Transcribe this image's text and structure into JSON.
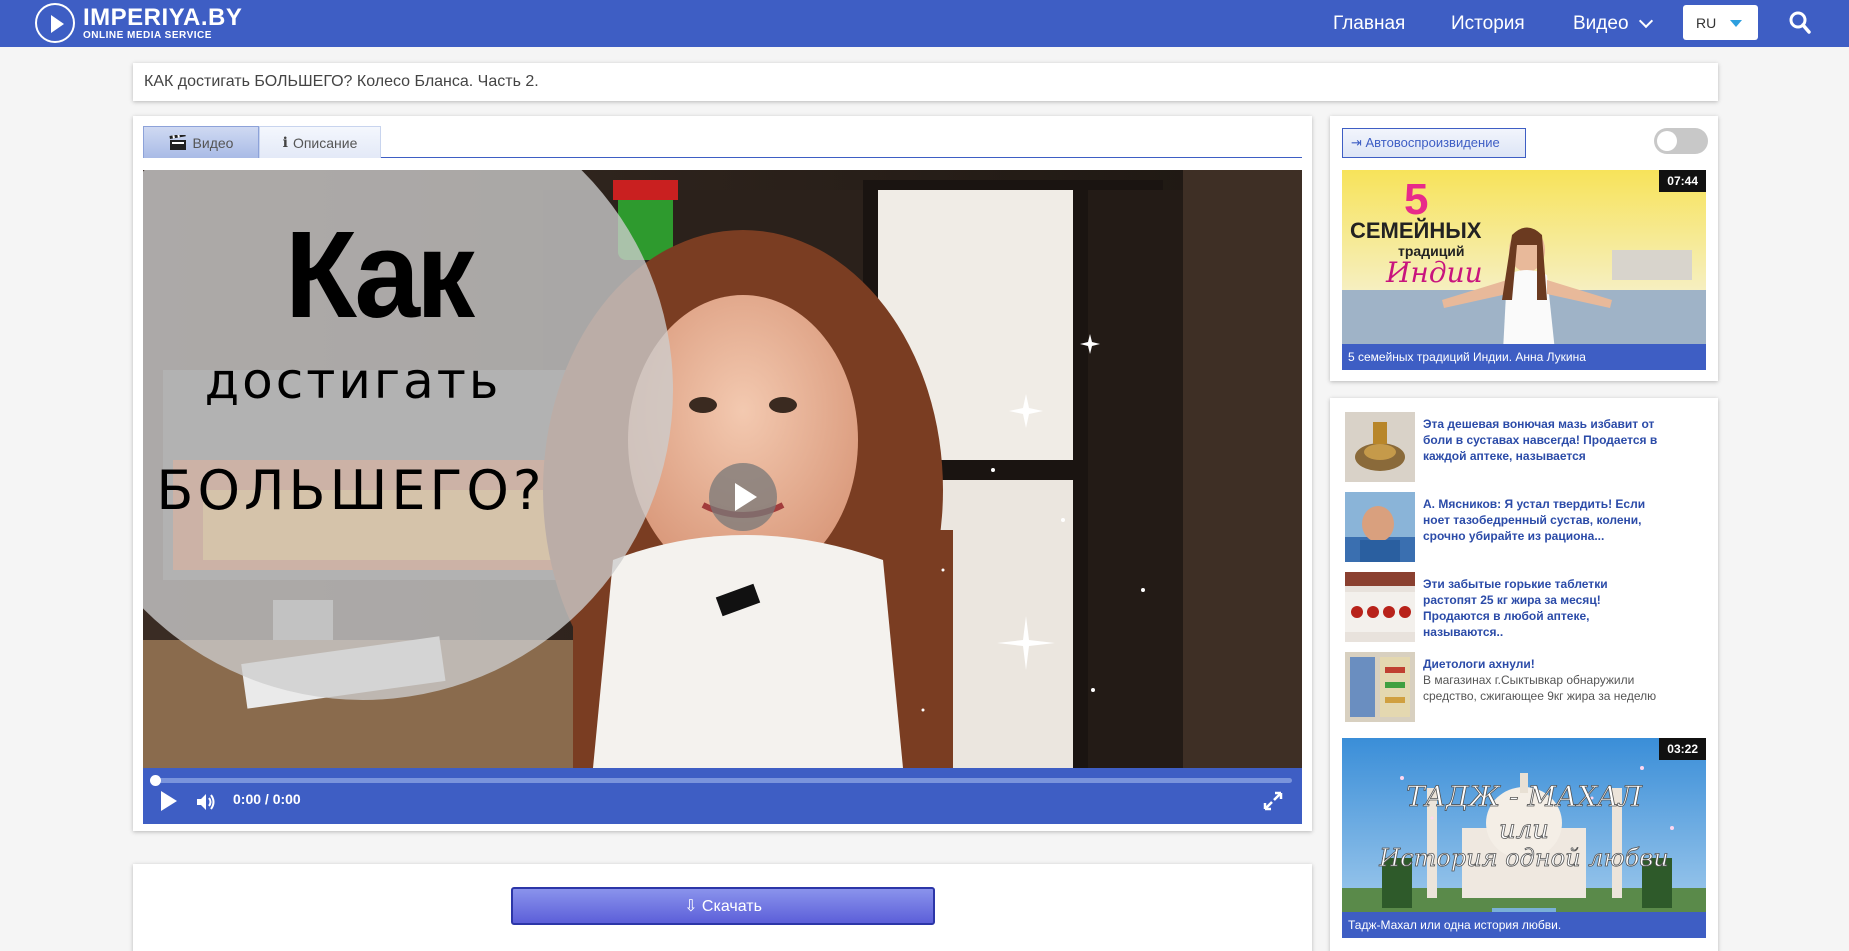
{
  "header": {
    "logo_name": "IMPERIYA.BY",
    "logo_sub": "ONLINE MEDIA SERVICE",
    "nav": {
      "home": "Главная",
      "history": "История",
      "video": "Видео"
    },
    "lang": "RU"
  },
  "page_title": "КАК достигать БОЛЬШЕГО? Колесо Бланса. Часть 2.",
  "tabs": {
    "video": "Видео",
    "description": "Описание"
  },
  "video": {
    "overlay": [
      "Как",
      "достигать",
      "БОЛЬШЕГО?"
    ],
    "time": "0:00 / 0:00",
    "progress": 0
  },
  "download_label": "⇩ Скачать",
  "sidebar": {
    "autoplay_label": "⇥ Автовоспроизвидение",
    "autoplay_on": false,
    "cards": [
      {
        "duration": "07:44",
        "caption": "5 семейных традиций Индии. Анна Лукина",
        "thumb_text": [
          "5",
          "СЕМЕЙНЫХ",
          "традиций",
          "Индии"
        ]
      },
      {
        "duration": "03:22",
        "caption": "Тадж-Махал или одна история любви.",
        "thumb_text": [
          "ТАДЖ - МАХАЛ",
          "или",
          "История одной любви"
        ]
      }
    ],
    "ads": [
      {
        "title": "Эта дешевая вонючая мазь избавит от боли в суставах навсегда! Продается в каждой аптеке, называется",
        "body": ""
      },
      {
        "title": "А. Мясников: Я устал твердить! Если ноет тазобедренный сустав, колени, срочно убирайте из рациона...",
        "body": ""
      },
      {
        "title": "Эти забытые горькие таблетки растопят 25 кг жира за месяц! Продаются в любой аптеке, называются..",
        "body": ""
      },
      {
        "title": "Диетологи ахнули!",
        "body": "В магазинах г.Сыктывкар обнаружили средство, сжигающее 9кг жира за неделю"
      }
    ]
  },
  "colors": {
    "brand_blue": "#3e5ec4",
    "accent_light_blue": "#2e9fde",
    "download_purple": "#6a6fe0"
  }
}
